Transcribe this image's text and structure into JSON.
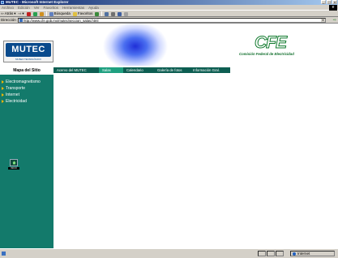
{
  "window": {
    "title": "MUTEC - Microsoft Internet Explorer",
    "controls": [
      "_",
      "□",
      "x"
    ]
  },
  "menu": {
    "items": [
      "Archivo",
      "Edición",
      "Ver",
      "Favoritos",
      "Herramientas",
      "Ayuda"
    ]
  },
  "toolbar": {
    "back_label": "Atrás",
    "search_label": "Búsqueda",
    "favorites_label": "Favoritos"
  },
  "address": {
    "label": "Dirección",
    "url": "http://www.cfe.gob.mx/mutec/seccion_salas.html",
    "go_label": "Ir"
  },
  "header": {
    "mutec_logo": "MUTEC",
    "mutec_subtitle": "MUSEO TECNOLÓGICO",
    "cfe_logo": "CFE",
    "cfe_name": "Comisión Federal de Electricidad"
  },
  "sidebar": {
    "title": "Mapa del Sitio",
    "items": [
      {
        "label": "Electromagnetismo"
      },
      {
        "label": "Transporte"
      },
      {
        "label": "Internet"
      },
      {
        "label": "Electricidad"
      }
    ],
    "home_label": "INICIO"
  },
  "nav": {
    "tabs": [
      {
        "label": "Acervo del MUTEC"
      },
      {
        "label": "Salas"
      },
      {
        "label": "Calendario"
      },
      {
        "label": "Galería de fotos"
      },
      {
        "label": "Información Gral."
      }
    ]
  },
  "status": {
    "zone": "Internet"
  },
  "colors": {
    "sidebar_bg": "#137a6b",
    "nav_dark": "#0d5e52",
    "nav_light": "#1fa080",
    "cfe_green": "#117a2e",
    "arrow": "#f2b700"
  }
}
